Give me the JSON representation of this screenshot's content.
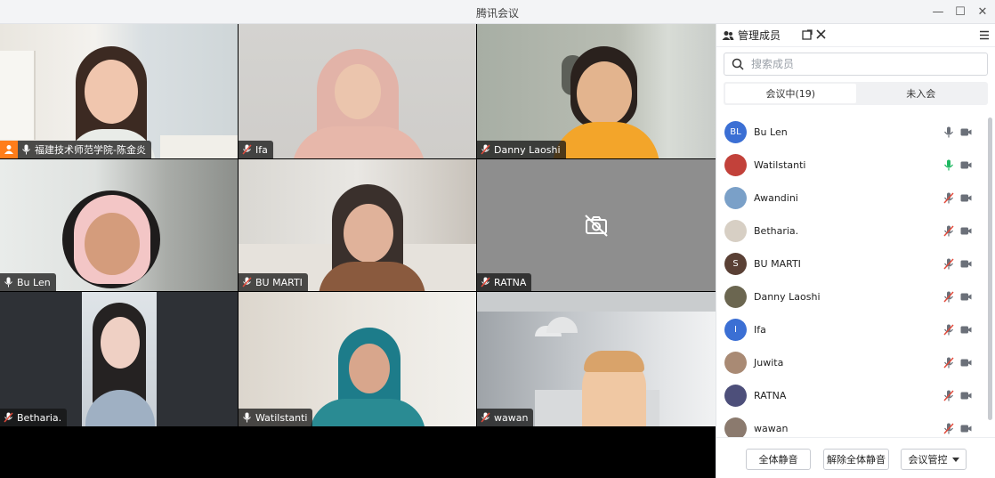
{
  "window": {
    "title": "腾讯会议"
  },
  "window_controls": {
    "minimize": "—",
    "maximize": "☐",
    "close": "✕"
  },
  "tiles": [
    {
      "name": "福建技术师范学院-陈金炎",
      "mic": "on",
      "host": true
    },
    {
      "name": "Ifa",
      "mic": "muted"
    },
    {
      "name": "Danny Laoshi",
      "mic": "muted"
    },
    {
      "name": "Bu Len",
      "mic": "on"
    },
    {
      "name": "BU MARTI",
      "mic": "muted"
    },
    {
      "name": "RATNA",
      "mic": "muted",
      "camera": "off"
    },
    {
      "name": "Betharia.",
      "mic": "muted"
    },
    {
      "name": "Watilstanti",
      "mic": "on",
      "speaking": true
    },
    {
      "name": "wawan",
      "mic": "muted"
    }
  ],
  "panel": {
    "title": "管理成员",
    "search_placeholder": "搜索成员",
    "tab_in_meeting": "会议中(19)",
    "tab_not_joined": "未入会",
    "members": [
      {
        "name": "Bu Len",
        "avatar_text": "BL",
        "avatar_color": "#3b6fd4",
        "mic": "on"
      },
      {
        "name": "Watilstanti",
        "avatar_text": "",
        "avatar_color": "#c2413a",
        "mic": "speaking"
      },
      {
        "name": "Awandini",
        "avatar_text": "",
        "avatar_color": "#7aa0c8",
        "mic": "muted"
      },
      {
        "name": "Betharia.",
        "avatar_text": "",
        "avatar_color": "#d7cfc4",
        "mic": "muted"
      },
      {
        "name": "BU MARTI",
        "avatar_text": "S",
        "avatar_color": "#5a4035",
        "mic": "muted"
      },
      {
        "name": "Danny Laoshi",
        "avatar_text": "",
        "avatar_color": "#6b6650",
        "mic": "muted"
      },
      {
        "name": "Ifa",
        "avatar_text": "I",
        "avatar_color": "#3b6fd4",
        "mic": "muted"
      },
      {
        "name": "Juwita",
        "avatar_text": "",
        "avatar_color": "#a98a74",
        "mic": "muted"
      },
      {
        "name": "RATNA",
        "avatar_text": "",
        "avatar_color": "#4d4f7a",
        "mic": "muted"
      },
      {
        "name": "wawan",
        "avatar_text": "",
        "avatar_color": "#8b7a6e",
        "mic": "muted"
      }
    ],
    "footer": {
      "mute_all": "全体静音",
      "unmute_all": "解除全体静音",
      "controls": "会议管控"
    }
  },
  "colors": {
    "host_badge": "#ff7d1a",
    "speaking": "#1fb861",
    "muted": "#e24b3c",
    "accent": "#3b6fd4"
  }
}
